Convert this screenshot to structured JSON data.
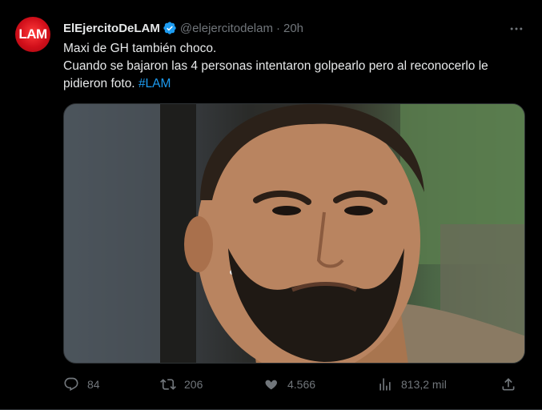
{
  "tweet": {
    "author_name": "ElEjercitoDeLAM",
    "avatar_text": "LAM",
    "handle": "@elejercitodelam",
    "separator": "·",
    "time": "20h",
    "lines": [
      "Maxi de GH también choco.",
      "Cuando se bajaron las 4 personas intentaron golpearlo pero al reconocerlo le pidieron foto."
    ],
    "hashtag": "#LAM"
  },
  "actions": {
    "replies": "84",
    "retweets": "206",
    "likes": "4.566",
    "views": "813,2 mil"
  },
  "icons": [
    "verified-badge-icon",
    "more-icon",
    "reply-icon",
    "retweet-icon",
    "like-icon",
    "views-icon",
    "share-icon"
  ],
  "colors": {
    "background": "#000000",
    "text": "#e7e9ea",
    "muted": "#71767b",
    "accent": "#1d9bf0",
    "avatar": "#d10f1a"
  }
}
